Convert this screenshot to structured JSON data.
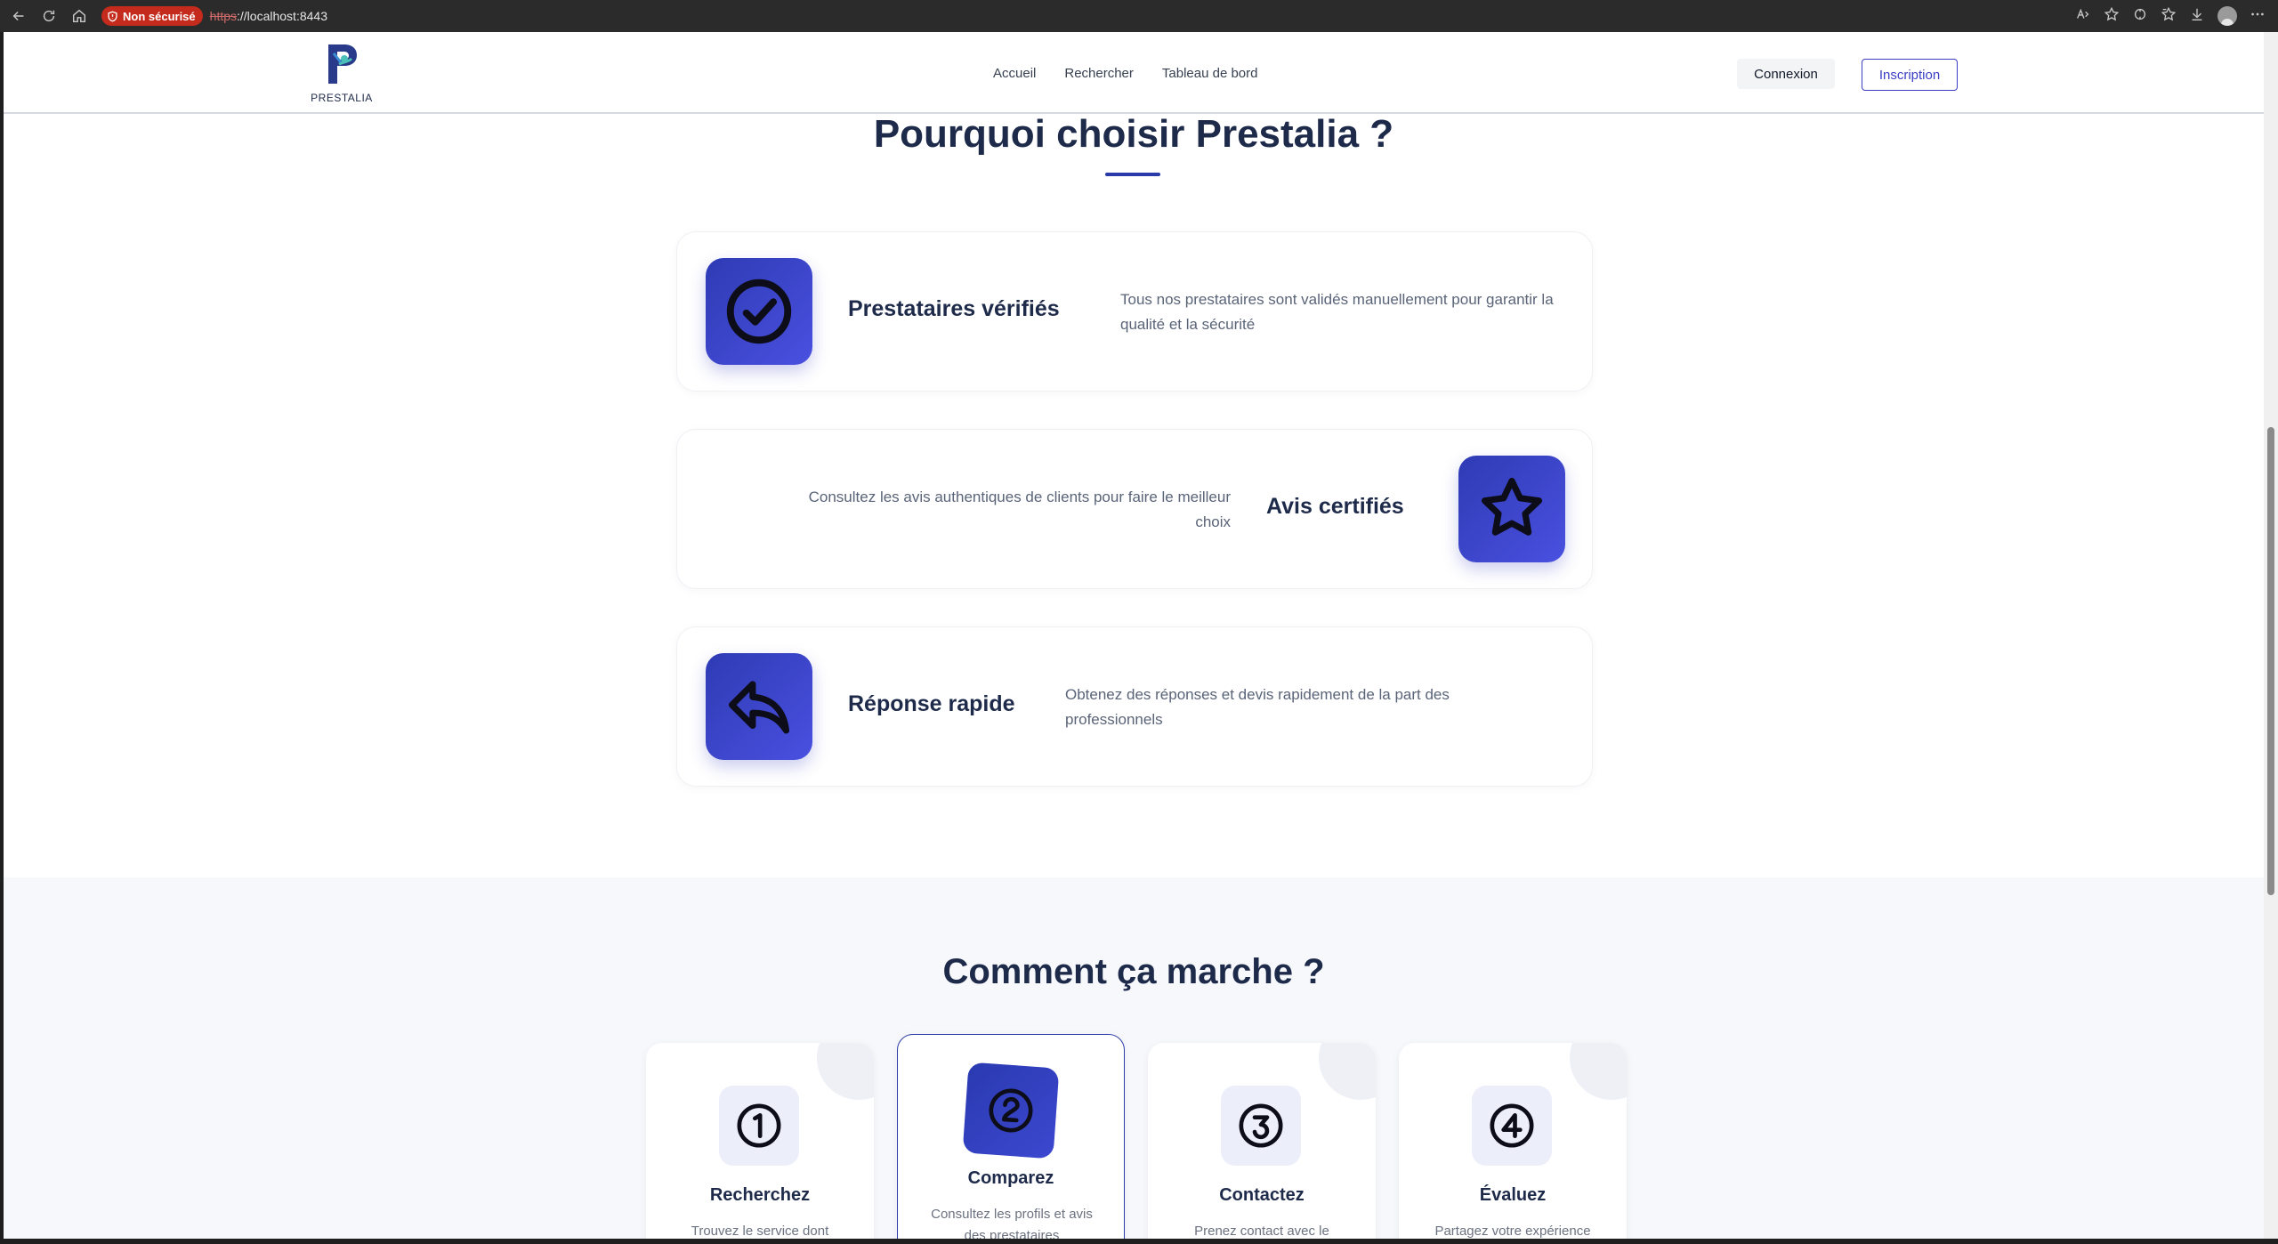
{
  "browser": {
    "security_label": "Non sécurisé",
    "url_scheme": "https",
    "url_rest": "://localhost:8443"
  },
  "header": {
    "logo_text": "PRESTALIA",
    "nav": [
      "Accueil",
      "Rechercher",
      "Tableau de bord"
    ],
    "login_label": "Connexion",
    "signup_label": "Inscription"
  },
  "why": {
    "title": "Pourquoi choisir Prestalia ?",
    "features": [
      {
        "title": "Prestataires vérifiés",
        "desc": "Tous nos prestataires sont validés manuellement pour garantir la qualité et la sécurité",
        "icon": "check-circle-icon"
      },
      {
        "title": "Avis certifiés",
        "desc": "Consultez les avis authentiques de clients pour faire le meilleur choix",
        "icon": "star-icon"
      },
      {
        "title": "Réponse rapide",
        "desc": "Obtenez des réponses et devis rapidement de la part des professionnels",
        "icon": "reply-icon"
      }
    ]
  },
  "how": {
    "title": "Comment ça marche ?",
    "steps": [
      {
        "title": "Recherchez",
        "desc": "Trouvez le service dont"
      },
      {
        "title": "Comparez",
        "desc": "Consultez les profils et avis des prestataires"
      },
      {
        "title": "Contactez",
        "desc": "Prenez contact avec le"
      },
      {
        "title": "Évaluez",
        "desc": "Partagez votre expérience"
      }
    ]
  },
  "colors": {
    "accent": "#3b3fc4",
    "heading": "#1e2a4a",
    "icon_gradient_start": "#2e3bb4",
    "icon_gradient_end": "#4a50e0"
  }
}
